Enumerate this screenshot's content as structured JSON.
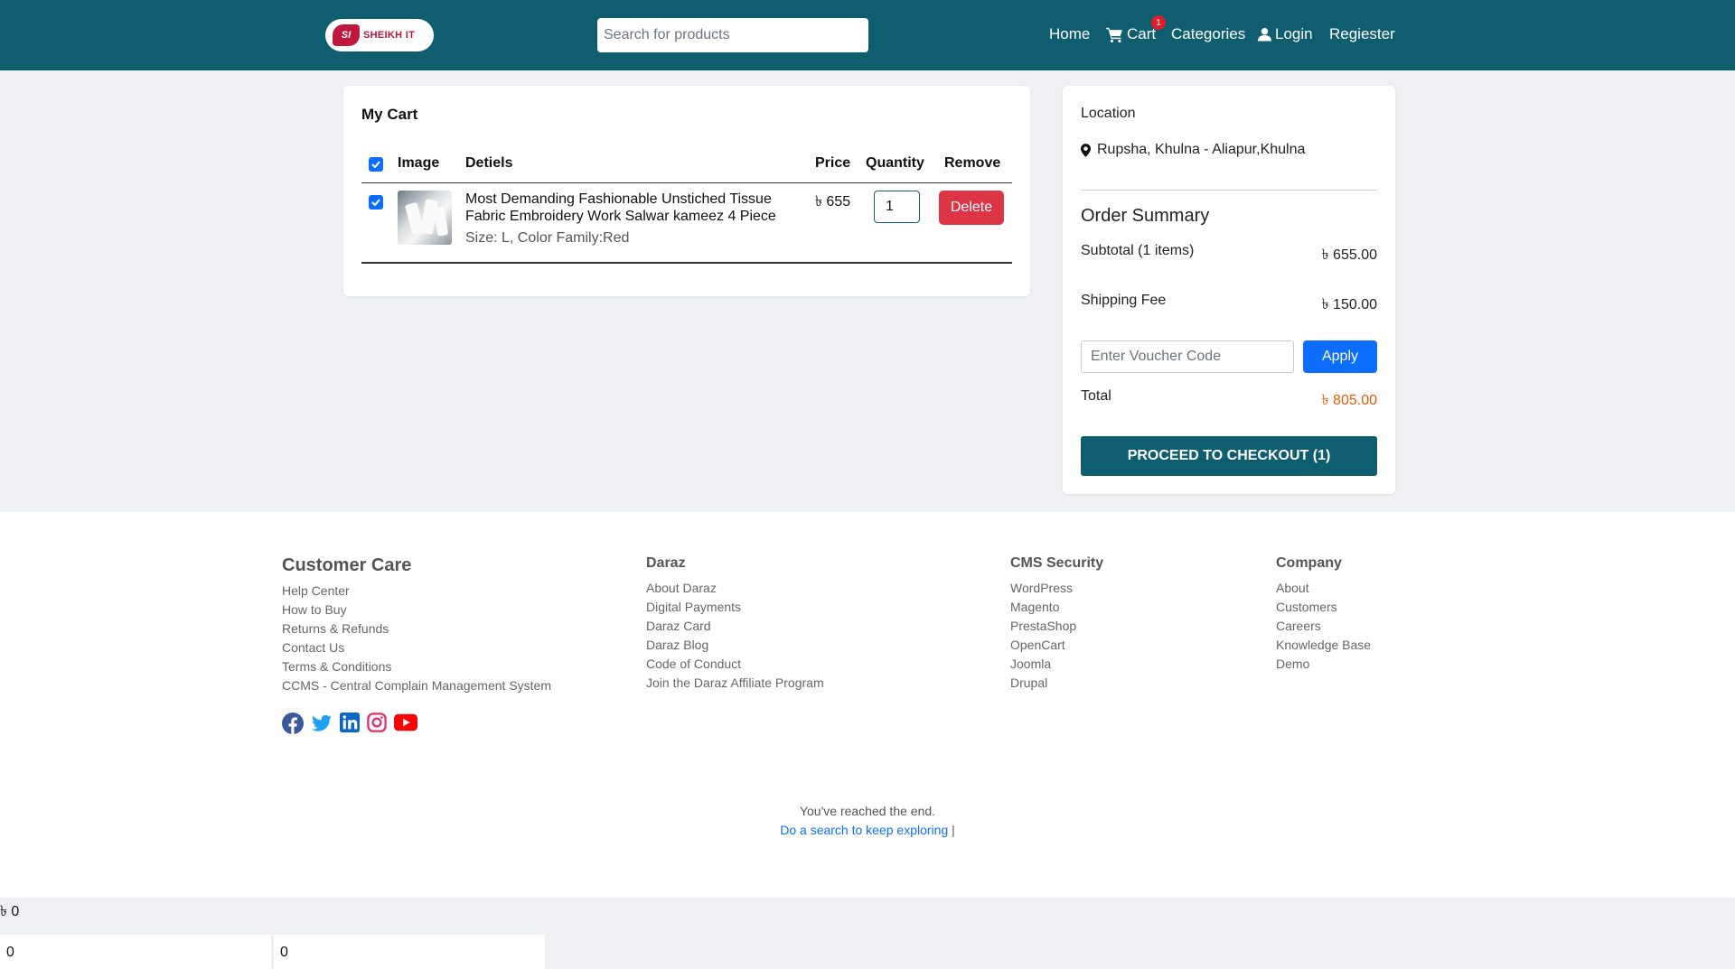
{
  "header": {
    "logo_text": "SHEIKH IT",
    "logo_mark": "SI",
    "search_placeholder": "Search for products",
    "nav": {
      "home": "Home",
      "cart": "Cart",
      "cart_count": "1",
      "categories": "Categories",
      "login": "Login",
      "register": "Regiester"
    }
  },
  "cart": {
    "title": "My Cart",
    "columns": {
      "image": "Image",
      "details": "Detiels",
      "price": "Price",
      "quantity": "Quantity",
      "remove": "Remove"
    },
    "items": [
      {
        "name": "Most Demanding Fashionable Unstiched Tissue Fabric Embroidery Work Salwar kameez 4 Piece",
        "variation": "Size: L, Color Family:Red",
        "price": "৳ 655",
        "quantity": "1",
        "remove_label": "Delete",
        "checked": true
      }
    ]
  },
  "summary": {
    "location_label": "Location",
    "location_value": "Rupsha, Khulna - Aliapur,Khulna",
    "heading": "Order Summary",
    "subtotal_label": "Subtotal (1 items)",
    "subtotal_value": "৳ 655.00",
    "shipping_label": "Shipping Fee",
    "shipping_value": "৳ 150.00",
    "voucher_placeholder": "Enter Voucher Code",
    "apply_label": "Apply",
    "total_label": "Total",
    "total_value": "৳ 805.00",
    "checkout_label": "PROCEED TO CHECKOUT (1)"
  },
  "footer": {
    "columns": [
      {
        "heading": "Customer Care",
        "links": [
          "Help Center",
          "How to Buy",
          "Returns & Refunds",
          "Contact Us",
          "Terms & Conditions",
          "CCMS - Central Complain Management System"
        ]
      },
      {
        "heading": "Daraz",
        "links": [
          "About Daraz",
          "Digital Payments",
          "Daraz Card",
          "Daraz Blog",
          "Code of Conduct",
          "Join the Daraz Affiliate Program"
        ]
      },
      {
        "heading": "CMS Security",
        "links": [
          "WordPress",
          "Magento",
          "PrestaShop",
          "OpenCart",
          "Joomla",
          "Drupal"
        ]
      },
      {
        "heading": "Company",
        "links": [
          "About",
          "Customers",
          "Careers",
          "Knowledge Base",
          "Demo"
        ]
      }
    ],
    "socials": [
      "facebook-icon",
      "twitter-icon",
      "linkedin-icon",
      "instagram-icon",
      "youtube-icon"
    ],
    "end_text": "You've reached the end.",
    "explore_link": "Do a search to keep exploring",
    "explore_sep": "|"
  },
  "bottom": {
    "amount": "৳ 0",
    "box1": "0",
    "box2": "0"
  },
  "colors": {
    "header_bg": "#0f5e70",
    "delete": "#dc3545",
    "primary": "#0d6efd",
    "total": "#e8590c",
    "link": "#0d6efd"
  }
}
